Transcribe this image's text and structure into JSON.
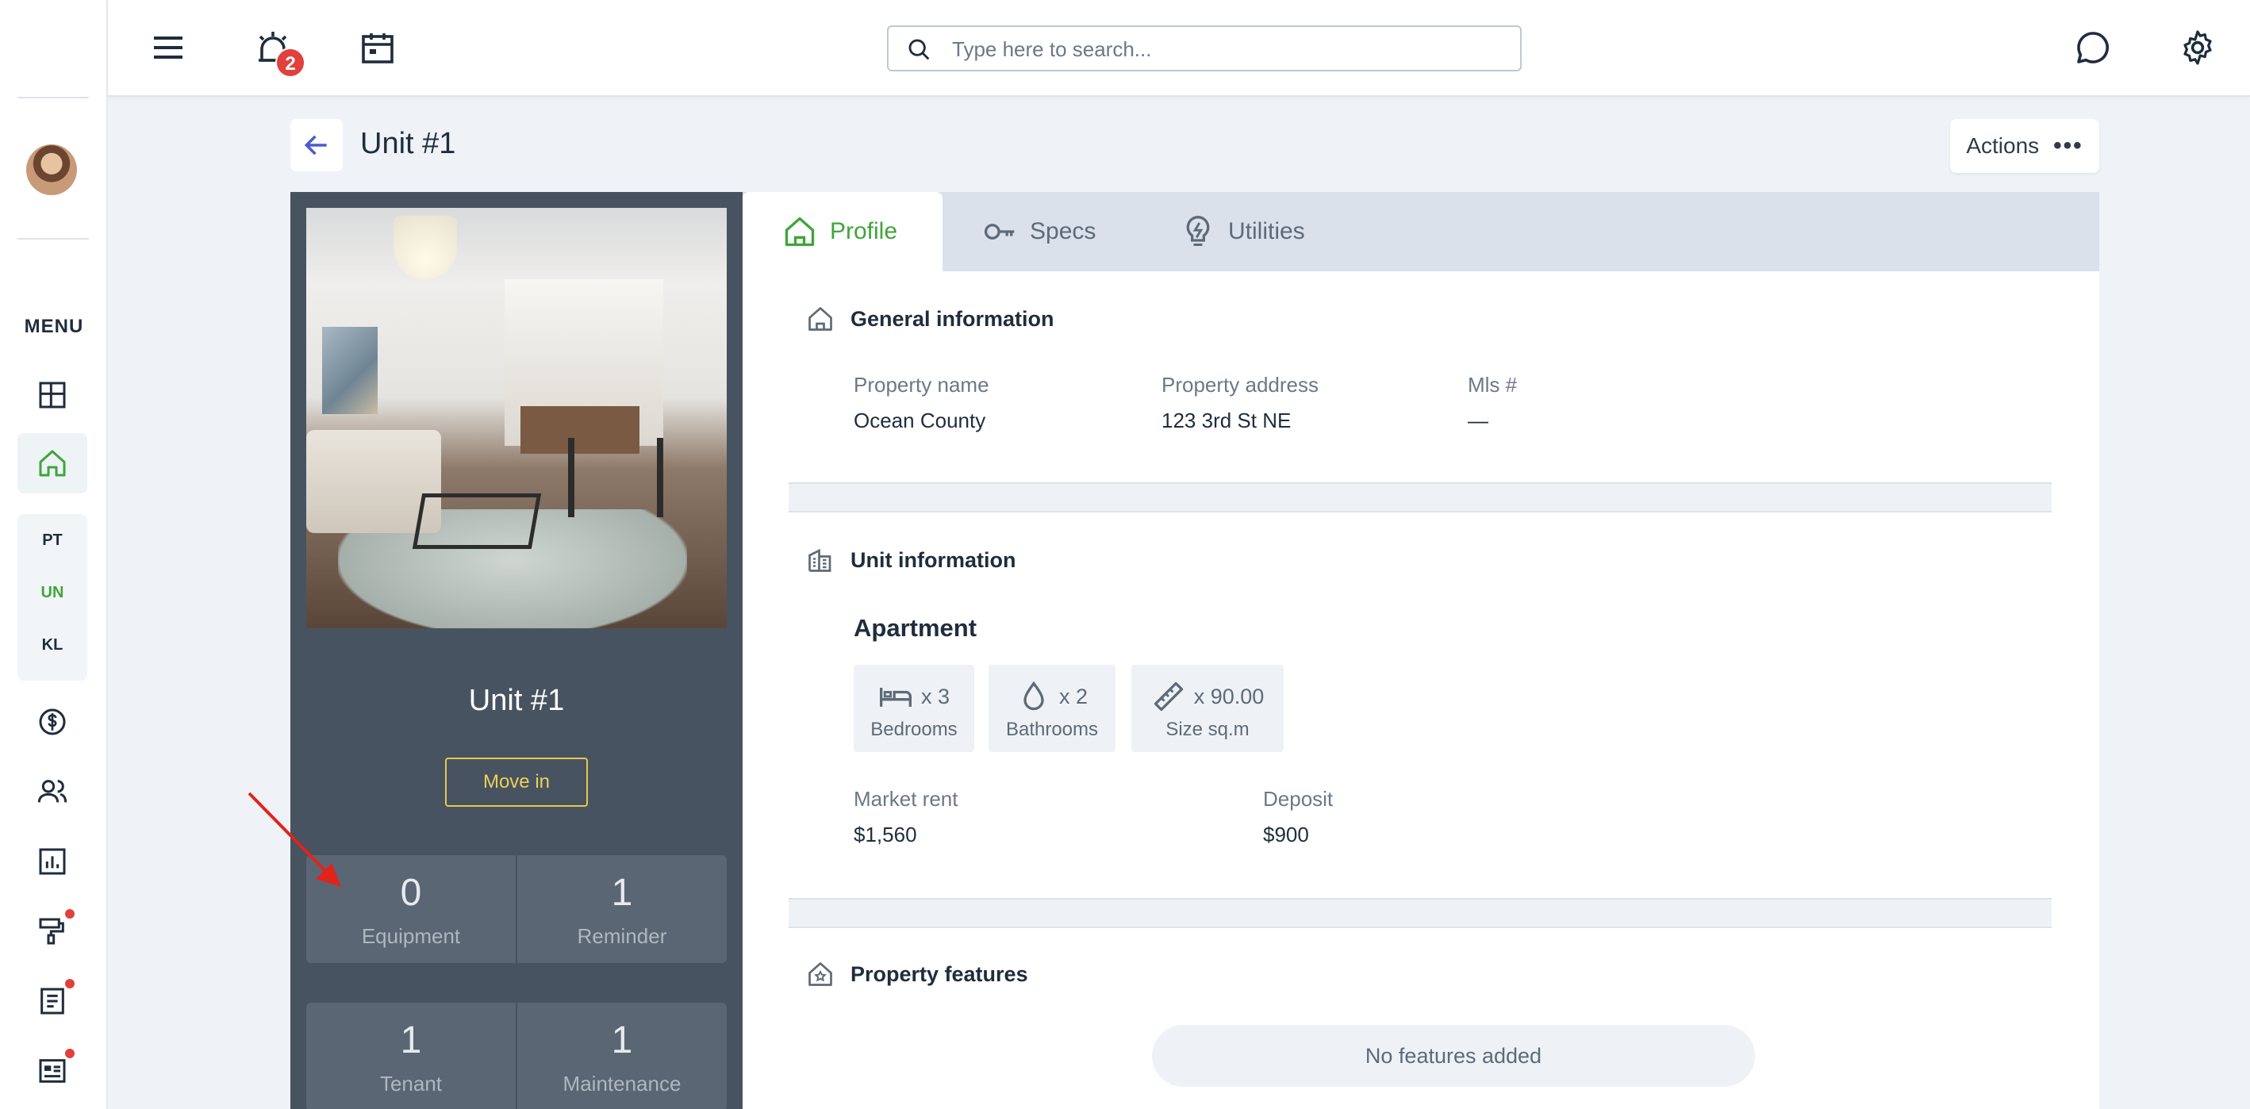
{
  "sidebar": {
    "menu_title": "MENU",
    "sub_items": [
      "PT",
      "UN",
      "KL"
    ],
    "icons": [
      "dashboard-icon",
      "home-icon",
      "dollar-icon",
      "users-icon",
      "reports-icon",
      "maintenance-icon",
      "documents-icon",
      "news-icon"
    ]
  },
  "topbar": {
    "notification_count": "2",
    "search_placeholder": "Type here to search..."
  },
  "header": {
    "title": "Unit #1",
    "actions_label": "Actions",
    "actions_dots": "•••"
  },
  "unit_card": {
    "name": "Unit #1",
    "move_in_label": "Move in",
    "stats": [
      {
        "value": "0",
        "label": "Equipment"
      },
      {
        "value": "1",
        "label": "Reminder"
      },
      {
        "value": "1",
        "label": "Tenant"
      },
      {
        "value": "1",
        "label": "Maintenance"
      }
    ]
  },
  "tabs": [
    {
      "label": "Profile",
      "active": true
    },
    {
      "label": "Specs",
      "active": false
    },
    {
      "label": "Utilities",
      "active": false
    }
  ],
  "general": {
    "heading": "General information",
    "fields": [
      {
        "label": "Property name",
        "value": "Ocean County"
      },
      {
        "label": "Property address",
        "value": "123 3rd St NE"
      },
      {
        "label": "Mls #",
        "value": "—"
      }
    ]
  },
  "unit_info": {
    "heading": "Unit information",
    "type": "Apartment",
    "specs": [
      {
        "value": "x 3",
        "label": "Bedrooms",
        "icon": "bed-icon"
      },
      {
        "value": "x 2",
        "label": "Bathrooms",
        "icon": "drop-icon"
      },
      {
        "value": "x 90.00",
        "label": "Size sq.m",
        "icon": "ruler-icon"
      }
    ],
    "fields": [
      {
        "label": "Market rent",
        "value": "$1,560"
      },
      {
        "label": "Deposit",
        "value": "$900"
      }
    ]
  },
  "features": {
    "heading": "Property features",
    "empty_text": "No features added"
  },
  "colors": {
    "accent_green": "#3fa53a",
    "card_bg": "#475360",
    "move_in_yellow": "#e9c84a",
    "badge_red": "#e0413b"
  }
}
